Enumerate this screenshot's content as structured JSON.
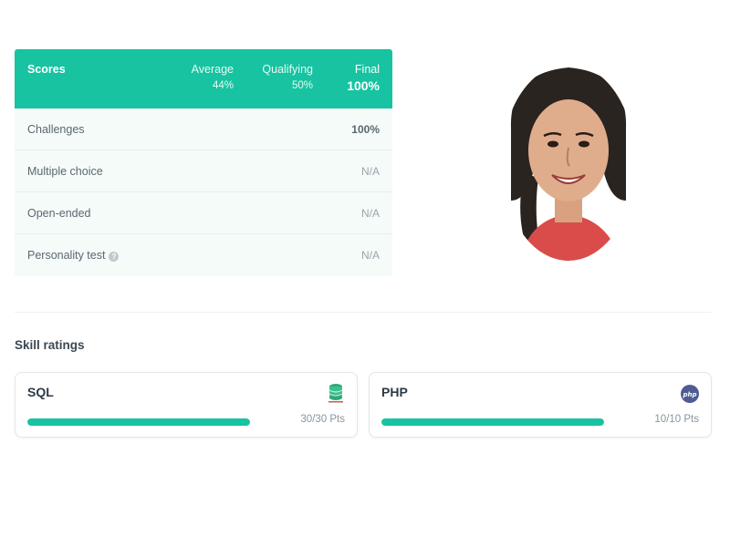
{
  "scores": {
    "header": {
      "title": "Scores",
      "average_label": "Average",
      "average_value": "44%",
      "qualifying_label": "Qualifying",
      "qualifying_value": "50%",
      "final_label": "Final",
      "final_value": "100%"
    },
    "rows": [
      {
        "label": "Challenges",
        "value": "100%"
      },
      {
        "label": "Multiple choice",
        "value": "N/A"
      },
      {
        "label": "Open-ended",
        "value": "N/A"
      },
      {
        "label": "Personality test",
        "value": "N/A",
        "help_icon": "question-circle-icon"
      }
    ]
  },
  "skills": {
    "title": "Skill ratings",
    "items": [
      {
        "name": "SQL",
        "points": "30/30 Pts",
        "progress": 1.0,
        "icon": "database-icon"
      },
      {
        "name": "PHP",
        "points": "10/10 Pts",
        "progress": 1.0,
        "icon": "php-logo-icon"
      }
    ]
  },
  "colors": {
    "accent": "#17c3a0",
    "row_bg": "#f4fbf9",
    "php_brand": "#4f5b93"
  }
}
